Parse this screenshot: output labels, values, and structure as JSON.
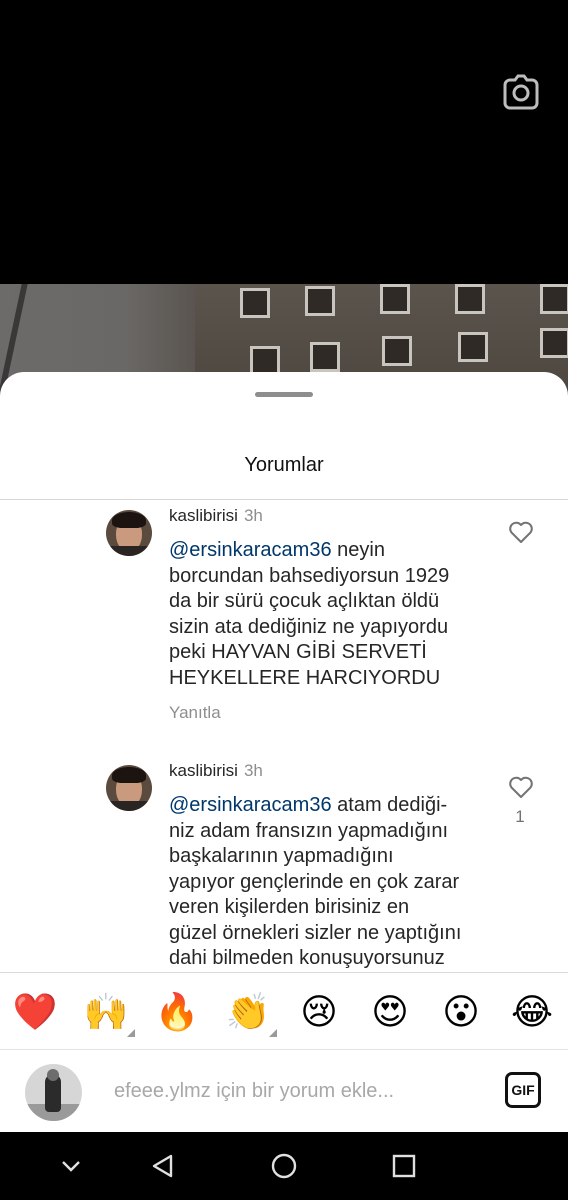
{
  "video": {
    "camera_icon": "camera-icon"
  },
  "sheet": {
    "title": "Yorumlar"
  },
  "comments": [
    {
      "username": "kaslibirisi",
      "time": "3h",
      "mention": "@ersinkaracam36",
      "text_lines": [
        " neyin",
        "borcundan bahsediyorsun 1929",
        "da bir sürü çocuk açlıktan öldü",
        "sizin ata dediğiniz ne yapıyordu",
        "peki HAYVAN GİBİ SERVETİ",
        "HEYKELLERE HARCIYORDU"
      ],
      "reply_label": "Yanıtla",
      "like_count": ""
    },
    {
      "username": "kaslibirisi",
      "time": "3h",
      "mention": "@ersinkaracam36",
      "text_lines": [
        " atam dediği-",
        "niz adam fransızın yapmadığını",
        "başkalarının yapmadığını",
        "yapıyor gençlerinde en çok zarar",
        "veren kişilerden birisiniz en",
        "güzel örnekleri sizler ne yaptığını",
        "dahi bilmeden konuşuyorsunuz"
      ],
      "reply_label": "",
      "like_count": "1"
    }
  ],
  "reactions": [
    {
      "emoji": "❤️",
      "name": "red-heart"
    },
    {
      "emoji": "🙌",
      "name": "raising-hands"
    },
    {
      "emoji": "🔥",
      "name": "fire"
    },
    {
      "emoji": "👏",
      "name": "clapping-hands"
    },
    {
      "emoji": "😢",
      "name": "crying-face"
    },
    {
      "emoji": "😍",
      "name": "heart-eyes"
    },
    {
      "emoji": "😮",
      "name": "surprised-face"
    },
    {
      "emoji": "😂",
      "name": "tears-of-joy"
    }
  ],
  "composer": {
    "placeholder": "efeee.ylmz için bir yorum ekle...",
    "gif_label": "GIF"
  },
  "colors": {
    "mention": "#00376b",
    "secondary_text": "#8e8e8e",
    "primary_text": "#262626"
  }
}
